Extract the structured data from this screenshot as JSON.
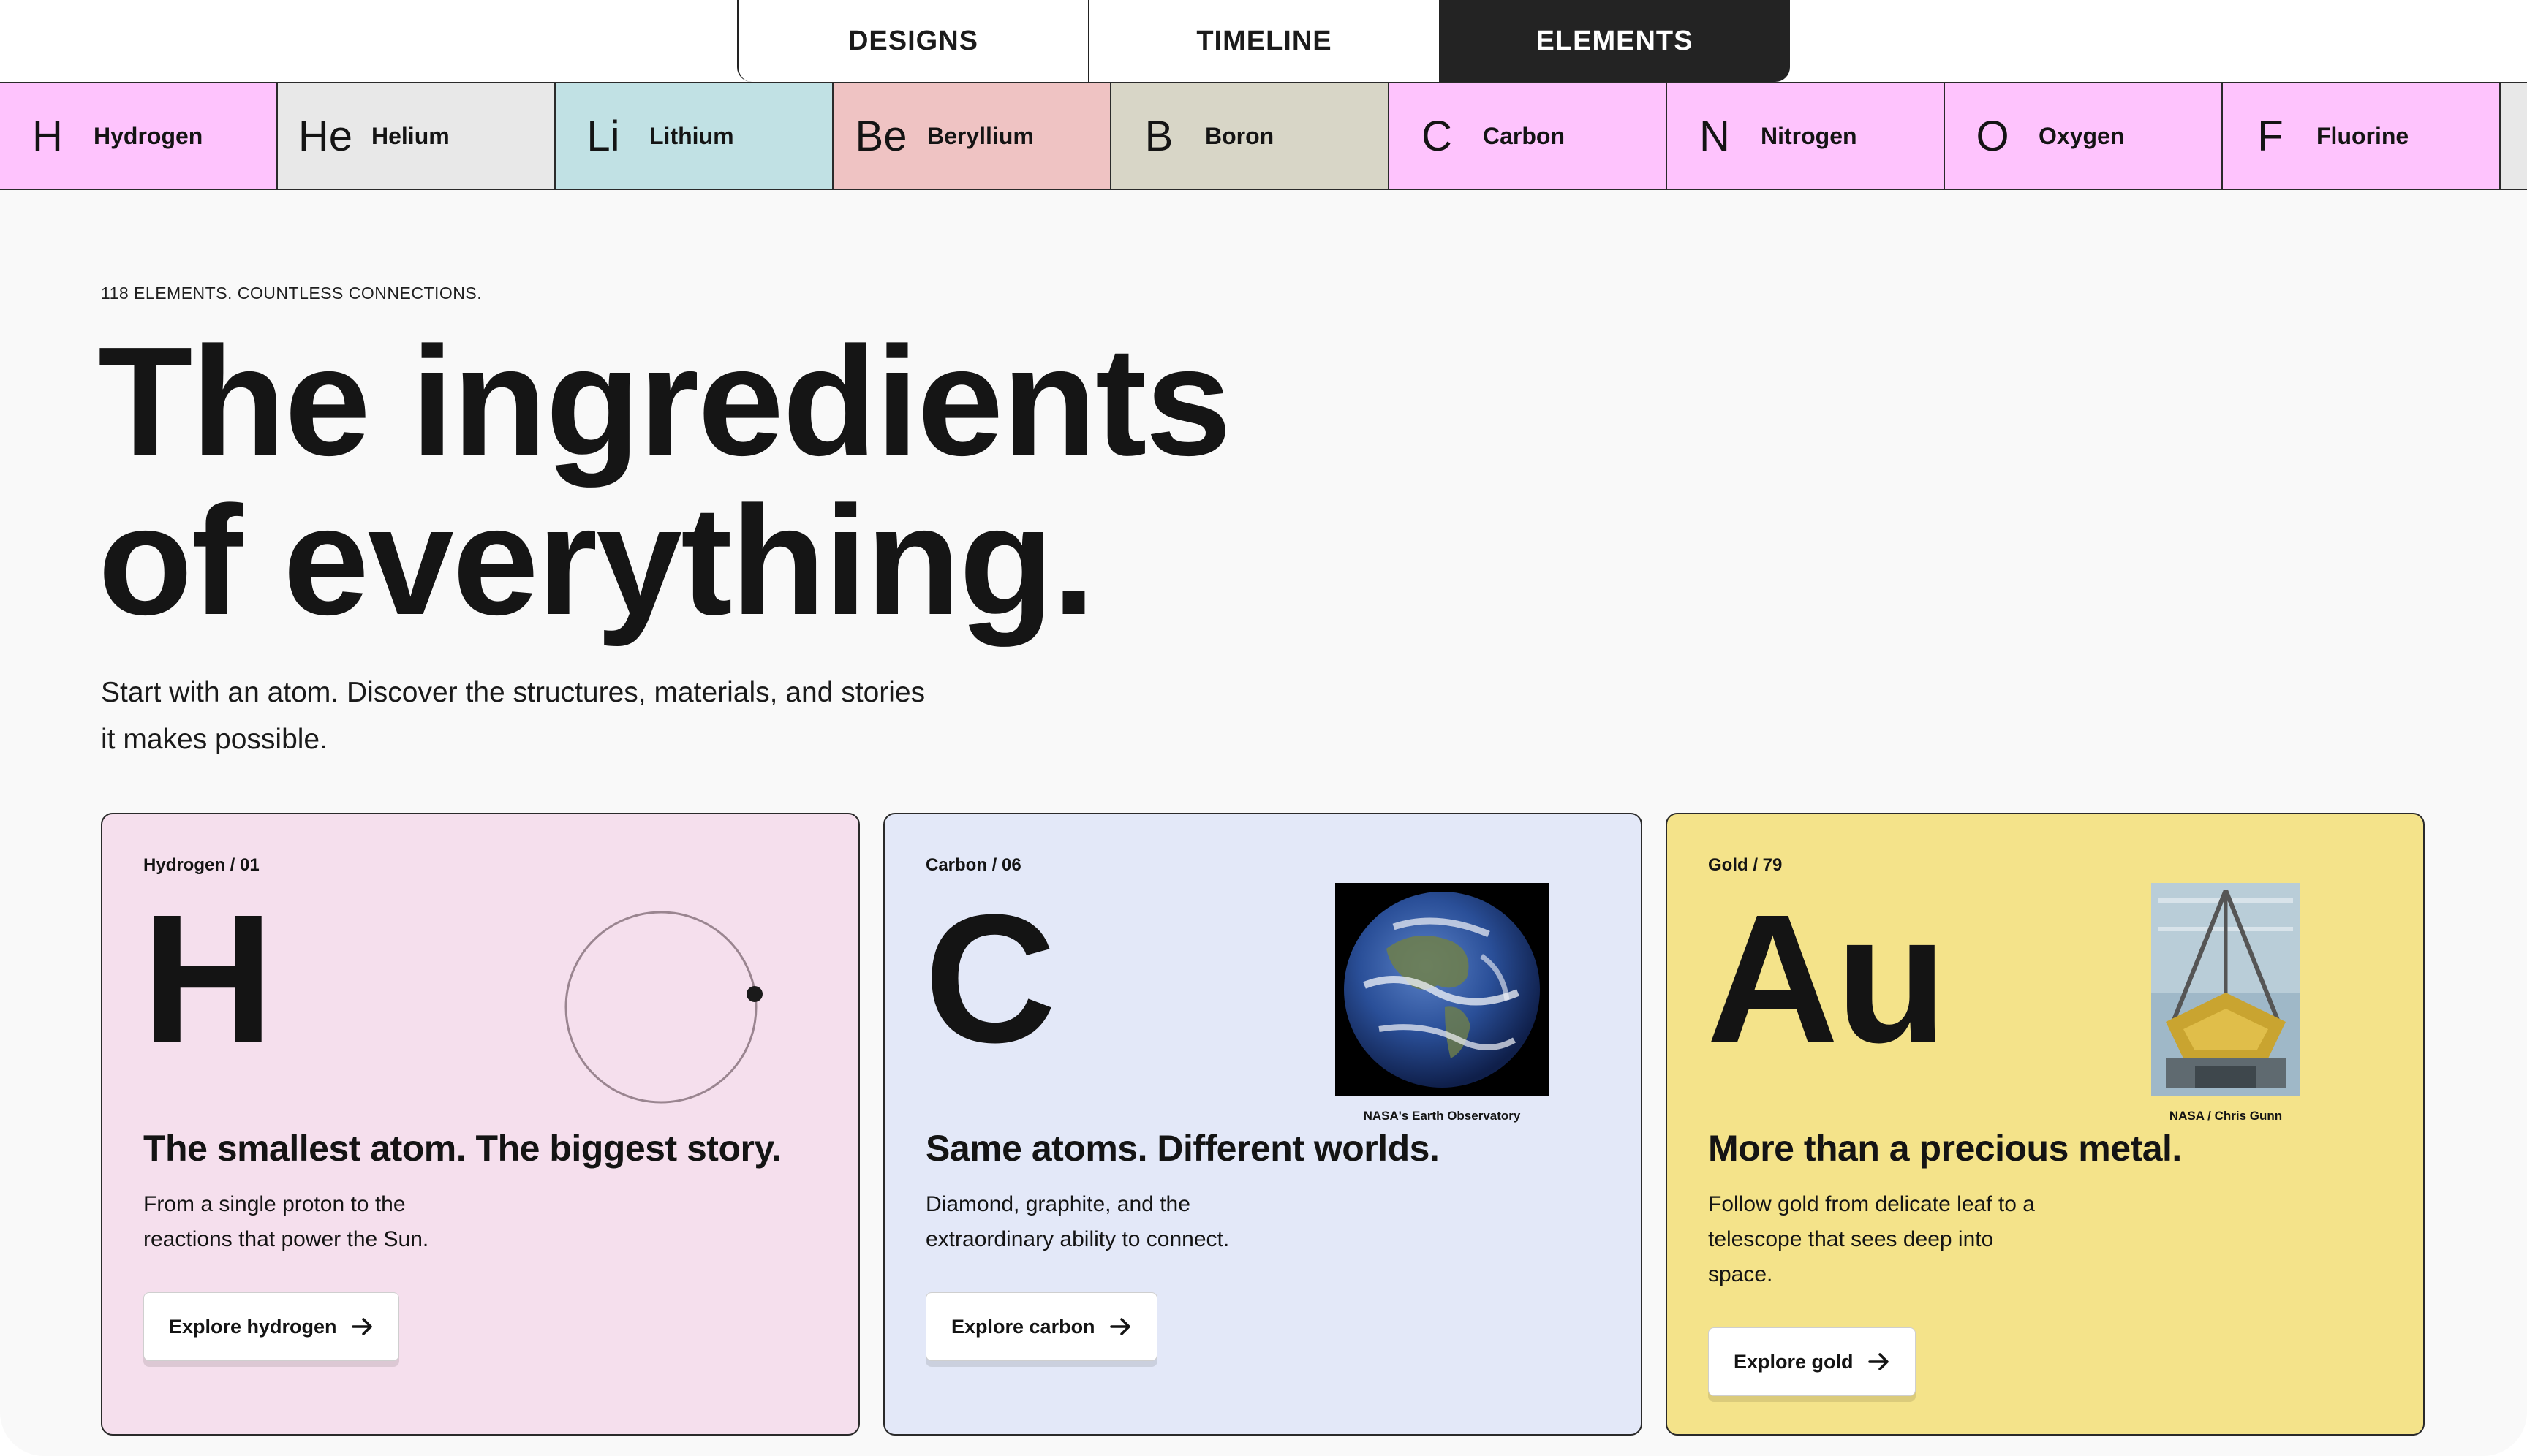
{
  "tabs": [
    {
      "label": "DESIGNS",
      "active": false
    },
    {
      "label": "TIMELINE",
      "active": false
    },
    {
      "label": "ELEMENTS",
      "active": true
    }
  ],
  "elements": [
    {
      "symbol": "H",
      "name": "Hydrogen",
      "color": "#fec3fd"
    },
    {
      "symbol": "He",
      "name": "Helium",
      "color": "#e8e8e8"
    },
    {
      "symbol": "Li",
      "name": "Lithium",
      "color": "#c1e1e4"
    },
    {
      "symbol": "Be",
      "name": "Beryllium",
      "color": "#efc3c3"
    },
    {
      "symbol": "B",
      "name": "Boron",
      "color": "#d8d6c7"
    },
    {
      "symbol": "C",
      "name": "Carbon",
      "color": "#fec3fd"
    },
    {
      "symbol": "N",
      "name": "Nitrogen",
      "color": "#fec3fd"
    },
    {
      "symbol": "O",
      "name": "Oxygen",
      "color": "#fec3fd"
    },
    {
      "symbol": "F",
      "name": "Fluorine",
      "color": "#fec3fd"
    }
  ],
  "hero": {
    "eyebrow": "118 ELEMENTS. COUNTLESS CONNECTIONS.",
    "title_line1": "The ingredients",
    "title_line2": "of everything.",
    "intro": "Start with an atom. Discover the structures, materials, and stories it makes possible."
  },
  "cards": {
    "hydrogen": {
      "label": "Hydrogen / 01",
      "symbol": "H",
      "title": "The smallest atom. The biggest story.",
      "description": "From a single proton to the reactions that power the Sun.",
      "button": "Explore hydrogen",
      "background": "#f5dfed"
    },
    "carbon": {
      "label": "Carbon / 06",
      "symbol": "C",
      "title": "Same atoms. Different worlds.",
      "description": "Diamond, graphite, and the extraordinary ability to connect.",
      "button": "Explore carbon",
      "photo_credit": "NASA's Earth Observatory",
      "background": "#e3e8f8"
    },
    "gold": {
      "label": "Gold / 79",
      "symbol": "Au",
      "title": "More than a precious metal.",
      "description": "Follow gold from delicate leaf to a telescope that sees deep into space.",
      "button": "Explore gold",
      "photo_credit": "NASA / Chris Gunn",
      "background": "#f4e38a"
    }
  }
}
